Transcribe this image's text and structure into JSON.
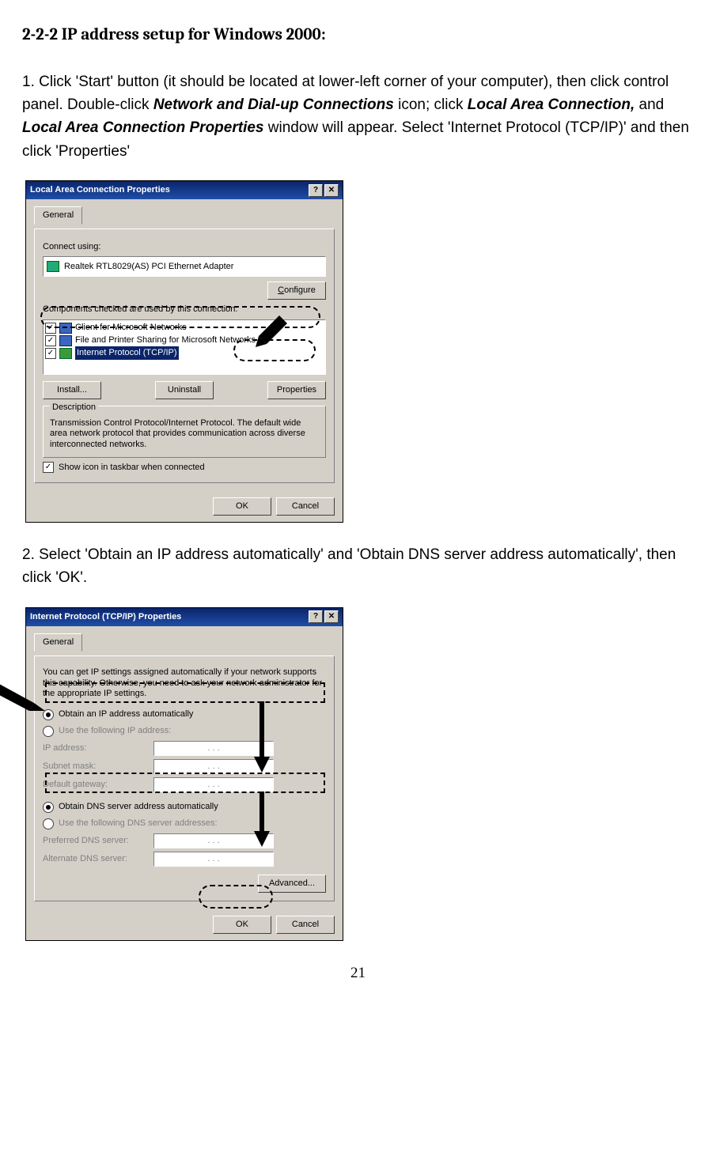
{
  "heading": "2-2-2 IP address setup for Windows 2000:",
  "para1": {
    "a": "1. Click 'Start' button (it should be located at lower-left corner of your computer), then click control panel. Double-click ",
    "b": "Network and Dial-up Connections",
    "c": " icon; click ",
    "d": "Local Area Connection,",
    "e": " and ",
    "f": "Local Area Connection Properties",
    "g": " window will appear. Select 'Internet Protocol (TCP/IP)' and then click 'Properties'"
  },
  "dlg1": {
    "title": "Local Area Connection Properties",
    "help": "?",
    "close": "✕",
    "tab": "General",
    "connect_using": "Connect using:",
    "adapter": "Realtek RTL8029(AS) PCI Ethernet Adapter",
    "configure": "Configure",
    "components_label": "Components checked are used by this connection:",
    "items": [
      "Client for Microsoft Networks",
      "File and Printer Sharing for Microsoft Networks",
      "Internet Protocol (TCP/IP)"
    ],
    "install": "Install...",
    "uninstall": "Uninstall",
    "properties": "Properties",
    "desc_label": "Description",
    "desc_text": "Transmission Control Protocol/Internet Protocol. The default wide area network protocol that provides communication across diverse interconnected networks.",
    "show_icon": "Show icon in taskbar when connected",
    "ok": "OK",
    "cancel": "Cancel"
  },
  "para2": "2. Select 'Obtain an IP address automatically' and 'Obtain DNS server address automatically', then click 'OK'.",
  "dlg2": {
    "title": "Internet Protocol (TCP/IP) Properties",
    "help": "?",
    "close": "✕",
    "tab": "General",
    "info": "You can get IP settings assigned automatically if your network supports this capability. Otherwise, you need to ask your network administrator for the appropriate IP settings.",
    "r1": "Obtain an IP address automatically",
    "r2": "Use the following IP address:",
    "ip": "IP address:",
    "mask": "Subnet mask:",
    "gw": "Default gateway:",
    "r3": "Obtain DNS server address automatically",
    "r4": "Use the following DNS server addresses:",
    "pdns": "Preferred DNS server:",
    "adns": "Alternate DNS server:",
    "dots": ".       .       .",
    "advanced": "Advanced...",
    "ok": "OK",
    "cancel": "Cancel"
  },
  "page_number": "21"
}
